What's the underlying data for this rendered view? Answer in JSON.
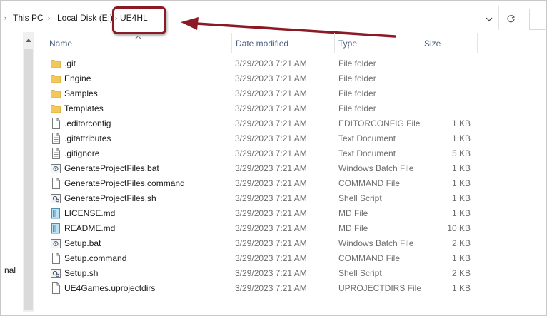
{
  "address": {
    "breadcrumbs": [
      "This PC",
      "Local Disk (E:)"
    ],
    "current": "UE4HL"
  },
  "nav": {
    "partial_label": "nal"
  },
  "columns": {
    "name": "Name",
    "date": "Date modified",
    "type": "Type",
    "size": "Size"
  },
  "files": [
    {
      "name": ".git",
      "date": "3/29/2023 7:21 AM",
      "type": "File folder",
      "size": "",
      "icon": "folder-icon"
    },
    {
      "name": "Engine",
      "date": "3/29/2023 7:21 AM",
      "type": "File folder",
      "size": "",
      "icon": "folder-icon"
    },
    {
      "name": "Samples",
      "date": "3/29/2023 7:21 AM",
      "type": "File folder",
      "size": "",
      "icon": "folder-icon"
    },
    {
      "name": "Templates",
      "date": "3/29/2023 7:21 AM",
      "type": "File folder",
      "size": "",
      "icon": "folder-icon"
    },
    {
      "name": ".editorconfig",
      "date": "3/29/2023 7:21 AM",
      "type": "EDITORCONFIG File",
      "size": "1 KB",
      "icon": "file-icon"
    },
    {
      "name": ".gitattributes",
      "date": "3/29/2023 7:21 AM",
      "type": "Text Document",
      "size": "1 KB",
      "icon": "text-file-icon"
    },
    {
      "name": ".gitignore",
      "date": "3/29/2023 7:21 AM",
      "type": "Text Document",
      "size": "5 KB",
      "icon": "text-file-icon"
    },
    {
      "name": "GenerateProjectFiles.bat",
      "date": "3/29/2023 7:21 AM",
      "type": "Windows Batch File",
      "size": "1 KB",
      "icon": "batch-file-icon"
    },
    {
      "name": "GenerateProjectFiles.command",
      "date": "3/29/2023 7:21 AM",
      "type": "COMMAND File",
      "size": "1 KB",
      "icon": "file-icon"
    },
    {
      "name": "GenerateProjectFiles.sh",
      "date": "3/29/2023 7:21 AM",
      "type": "Shell Script",
      "size": "1 KB",
      "icon": "script-file-icon"
    },
    {
      "name": "LICENSE.md",
      "date": "3/29/2023 7:21 AM",
      "type": "MD File",
      "size": "1 KB",
      "icon": "markdown-file-icon"
    },
    {
      "name": "README.md",
      "date": "3/29/2023 7:21 AM",
      "type": "MD File",
      "size": "10 KB",
      "icon": "markdown-file-icon"
    },
    {
      "name": "Setup.bat",
      "date": "3/29/2023 7:21 AM",
      "type": "Windows Batch File",
      "size": "2 KB",
      "icon": "batch-file-icon"
    },
    {
      "name": "Setup.command",
      "date": "3/29/2023 7:21 AM",
      "type": "COMMAND File",
      "size": "1 KB",
      "icon": "file-icon"
    },
    {
      "name": "Setup.sh",
      "date": "3/29/2023 7:21 AM",
      "type": "Shell Script",
      "size": "2 KB",
      "icon": "script-file-icon"
    },
    {
      "name": "UE4Games.uprojectdirs",
      "date": "3/29/2023 7:21 AM",
      "type": "UPROJECTDIRS File",
      "size": "1 KB",
      "icon": "file-icon"
    }
  ],
  "colors": {
    "annotation": "#8b1a24",
    "folder": "#f3c85a",
    "header_text": "#4d6082"
  }
}
